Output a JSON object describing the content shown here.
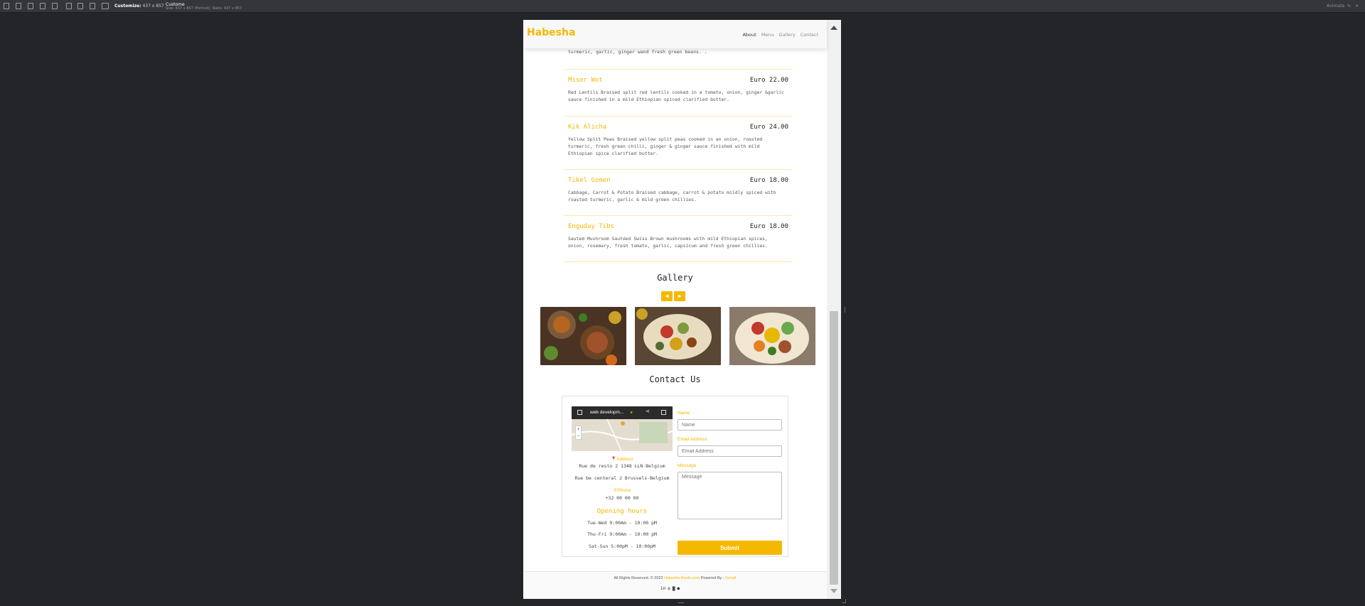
{
  "devtools": {
    "device_label": "Customize:",
    "dims_label": "437 x 857",
    "title_label": "Custome",
    "subtitle": "Size: 437 x 857 (Portrait), Ratio: 437 x 857",
    "right_label": "Animate"
  },
  "header": {
    "logo": "Habesha",
    "nav": [
      "About",
      "Menu",
      "Gallery",
      "Contact"
    ],
    "active_nav": "About"
  },
  "menu": {
    "previous_desc_tail": "turmeric, garlic, ginger wand fresh green beans. .",
    "items": [
      {
        "name": "Miser Wot",
        "price": "Euro 22.00",
        "desc": "Red Lentils Braised split red lentils cooked in a tomato, onion, ginger &garlic sauce finished in a mild Ethiopian spiced clarified butter."
      },
      {
        "name": "Kik Alicha",
        "price": "Euro 24.00",
        "desc": "Yellow Split Peas Braised yellow split peas cooked in an onion, roasted turmeric, fresh green chilli, ginger & ginger sauce finished with mild Ethiopian spice clarified butter."
      },
      {
        "name": "Tikel Gomen",
        "price": "Euro 18.00",
        "desc": "Cabbage, Carrot & Potato Braised cabbage, carrot & potato mildly spiced with roasted turmeric, garlic & mild green chillies."
      },
      {
        "name": "Enguday Tibs",
        "price": "Euro 18.00",
        "desc": "Sauted Mushroom Sautéed Swiss Brown mushrooms with mild Ethiopian spices, onion, rosemary, fresh tomato, garlic, capsicum and fresh green chillies."
      }
    ]
  },
  "gallery": {
    "title": "Gallery",
    "prev_symbol": "◆",
    "next_symbol": "◆"
  },
  "contact": {
    "title": "Contact Us",
    "map_title": "web developm...",
    "address_label": "Address",
    "address_lines": [
      "Rue de resto 2 1348 LLN-Belgium",
      "Rue be centeral 2 Brussels-Belgium"
    ],
    "phone_label": "Phone",
    "phone": "+32 00 00 00",
    "hours_title": "Opening hours",
    "hours": [
      "Tue-Wed 9:00Am - 10:00 pM",
      "Thu-Fri 9:00Am - 10:00 pM",
      "Sat-Sun 5:00pM - 10:00pM"
    ],
    "form": {
      "name_label": "Name",
      "name_placeholder": "Name",
      "email_label": "Email Address",
      "email_placeholder": "Email Address",
      "message_label": "Message",
      "message_placeholder": "Message",
      "submit_label": "Submit"
    }
  },
  "footer": {
    "copyright": "All Rights Reserved. © 2022",
    "site_link": "Habesha-Resto.com",
    "powered": "Powered By :",
    "author": "Senait"
  },
  "colors": {
    "accent": "#f5b800",
    "page_bg": "#242528"
  }
}
